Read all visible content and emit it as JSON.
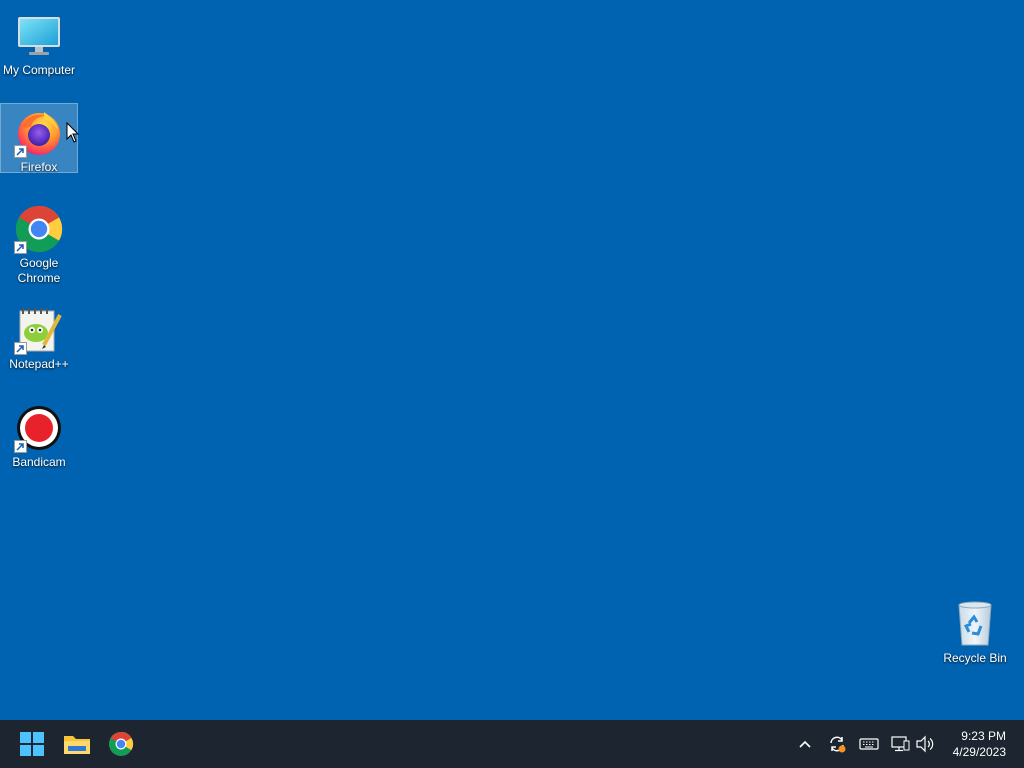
{
  "desktop": {
    "background_color": "#0063b1",
    "icons": [
      {
        "label": "My Computer",
        "icon": "monitor-icon",
        "shortcut": false,
        "selected": false
      },
      {
        "label": "Firefox",
        "icon": "firefox-icon",
        "shortcut": true,
        "selected": true
      },
      {
        "label": "Google\nChrome",
        "icon": "chrome-icon",
        "shortcut": true,
        "selected": false
      },
      {
        "label": "Notepad++",
        "icon": "notepadpp-icon",
        "shortcut": true,
        "selected": false
      },
      {
        "label": "Bandicam",
        "icon": "bandicam-icon",
        "shortcut": true,
        "selected": false
      },
      {
        "label": "Recycle Bin",
        "icon": "recycle-bin-icon",
        "shortcut": false,
        "selected": false
      }
    ]
  },
  "taskbar": {
    "background_color": "#1c2530",
    "pinned": [
      "start-windows-icon",
      "file-explorer-icon",
      "chrome-icon"
    ],
    "tray": [
      "chevron-up-icon",
      "sync-icon",
      "keyboard-icon",
      "network-icon",
      "volume-icon"
    ],
    "clock": {
      "time": "9:23 PM",
      "date": "4/29/2023"
    }
  }
}
